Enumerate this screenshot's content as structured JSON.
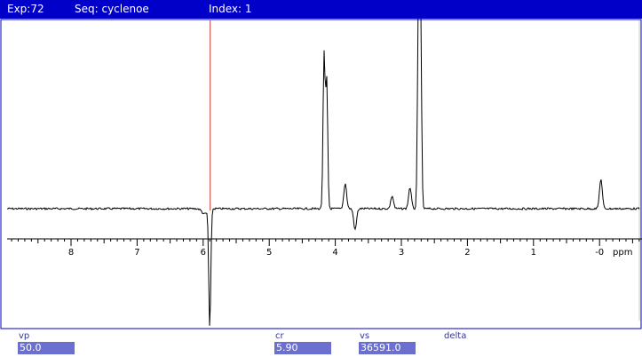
{
  "titlebar": {
    "experiment": "Exp:72",
    "sequence": "Seq: cyclenoe",
    "index": "Index: 1"
  },
  "axis": {
    "unit_label": "ppm",
    "ticks": [
      "8",
      "7",
      "6",
      "5",
      "4",
      "3",
      "2",
      "1",
      "-0"
    ]
  },
  "chart_data": {
    "type": "line",
    "x_axis": "ppm (reversed)",
    "xlim": [
      8.95,
      -0.7
    ],
    "cursor_ppm": 5.9,
    "peaks": [
      {
        "ppm": 5.9,
        "height": -2.8
      },
      {
        "ppm": 4.17,
        "height": 3.6
      },
      {
        "ppm": 4.13,
        "height": 3.0
      },
      {
        "ppm": 3.85,
        "height": 0.6
      },
      {
        "ppm": 3.7,
        "height": -0.5
      },
      {
        "ppm": 3.14,
        "height": 0.3
      },
      {
        "ppm": 2.87,
        "height": 0.5
      },
      {
        "ppm": 2.74,
        "height": 4.9
      },
      {
        "ppm": 2.71,
        "height": 4.6
      },
      {
        "ppm": -0.02,
        "height": 0.7
      }
    ],
    "colors": {
      "trace": "#000000",
      "cursor": "#c0392b",
      "frame": "#0000c8"
    }
  },
  "params": {
    "vp": {
      "label": "vp",
      "value": "50.0"
    },
    "cr": {
      "label": "cr",
      "value": "5.90"
    },
    "vs": {
      "label": "vs",
      "value": "36591.0"
    },
    "delta": {
      "label": "delta"
    }
  }
}
